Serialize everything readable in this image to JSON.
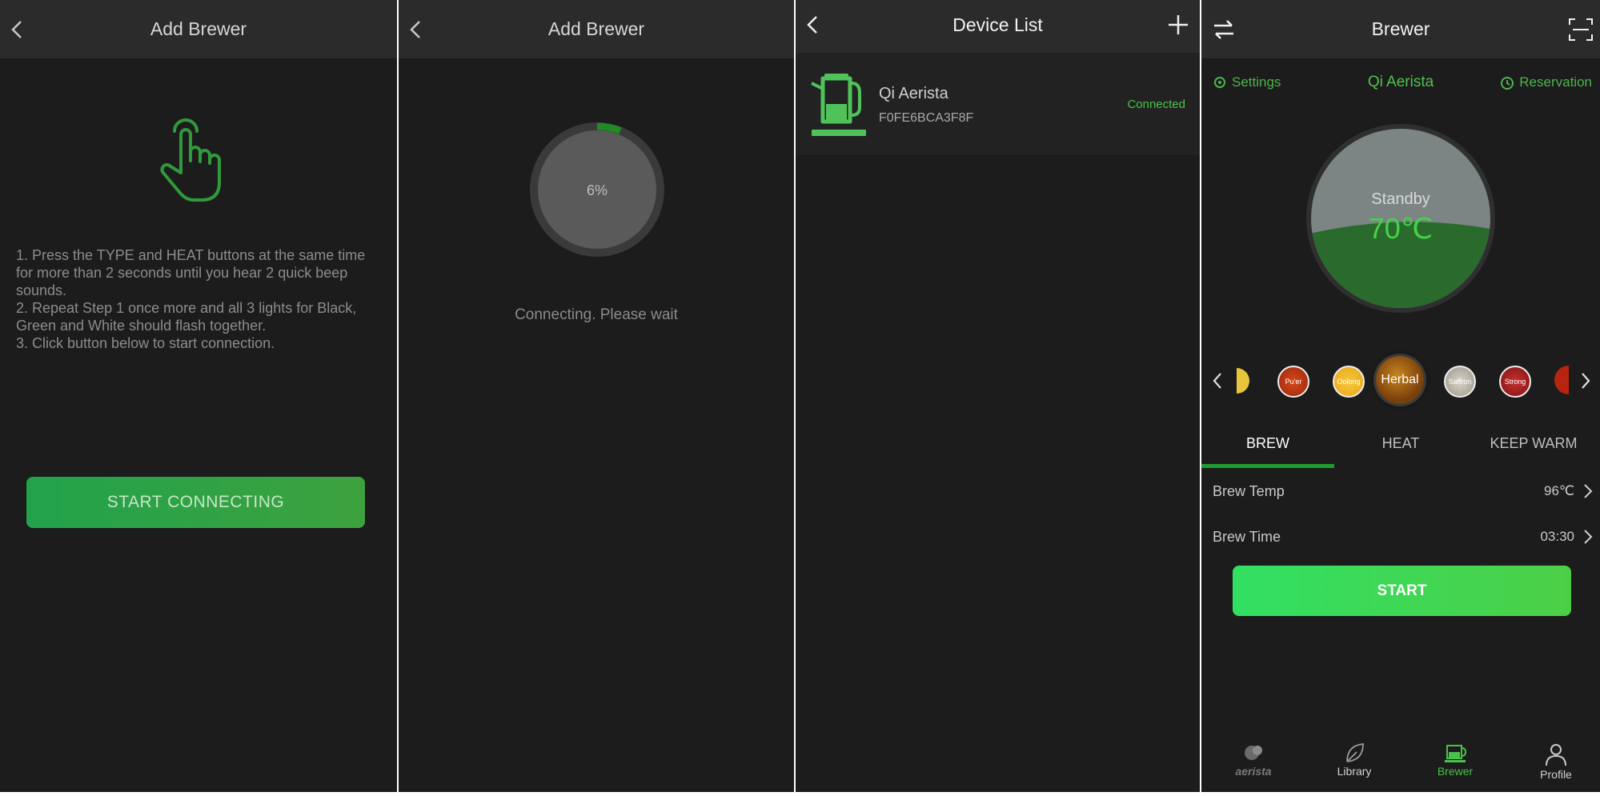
{
  "panel1": {
    "title": "Add Brewer",
    "back_icon": "chevron-left-icon",
    "hand_icon": "tap-hand-icon",
    "steps": [
      "1. Press the TYPE and HEAT buttons at the same time for more than 2 seconds until you hear 2 quick beep sounds.",
      "2. Repeat Step 1 once more and all 3 lights for Black, Green and White should flash together.",
      "3. Click button below to start connection."
    ],
    "button_label": "START CONNECTING"
  },
  "panel2": {
    "title": "Add Brewer",
    "progress_label": "6%",
    "progress": 0.06,
    "status": "Connecting. Please wait"
  },
  "panel3": {
    "title": "Device List",
    "add_icon": "plus-icon",
    "device": {
      "icon": "kettle-icon",
      "name": "Qi Aerista",
      "mac": "F0FE6BCA3F8F",
      "status": "Connected"
    }
  },
  "panel4": {
    "title": "Brewer",
    "settings_label": "Settings",
    "device_name": "Qi Aerista",
    "reservation_label": "Reservation",
    "state": "Standby",
    "temperature": "70℃",
    "teas": [
      "",
      "Pu'er",
      "Oolong",
      "Herbal",
      "Saffron",
      "Strong",
      ""
    ],
    "selected_tea": "Herbal",
    "tabs": [
      "BREW",
      "HEAT",
      "KEEP WARM"
    ],
    "active_tab": "BREW",
    "brew_temp_label": "Brew Temp",
    "brew_temp_value": "96℃",
    "brew_time_label": "Brew Time",
    "brew_time_value": "03:30",
    "start_label": "START",
    "nav": [
      {
        "label": "aerista",
        "icon": "aerista-icon"
      },
      {
        "label": "Library",
        "icon": "leaf-icon"
      },
      {
        "label": "Brewer",
        "icon": "brewer-icon"
      },
      {
        "label": "Profile",
        "icon": "person-icon"
      }
    ],
    "active_nav": "Brewer"
  },
  "colors": {
    "accent": "#3fbf47",
    "panel_bg": "#1c1c1c",
    "topbar_bg": "#2b2b2b"
  }
}
